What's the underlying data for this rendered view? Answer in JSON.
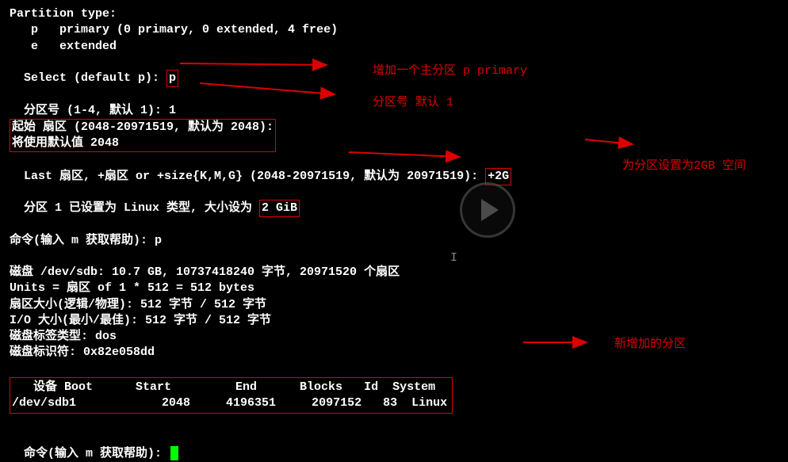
{
  "terminal": {
    "partition_type_header": "Partition type:",
    "opt_primary": "   p   primary (0 primary, 0 extended, 4 free)",
    "opt_extended": "   e   extended",
    "select_prompt": "Select (default p): ",
    "select_value": "p",
    "part_num_prompt": "分区号 (1-4, 默认 1): ",
    "part_num_value": "1",
    "start_sector_line": "起始 扇区 (2048-20971519, 默认为 2048):",
    "default_used_line": "将使用默认值 2048",
    "last_sector_prompt": "Last 扇区, +扇区 or +size{K,M,G} (2048-20971519, 默认为 20971519): ",
    "last_sector_value": "+2G",
    "set_partition_prefix": "分区 1 已设置为 Linux 类型, 大小设为 ",
    "set_partition_size": "2 GiB",
    "cmd_prompt1": "命令(输入 m 获取帮助): p",
    "disk_info": "磁盘 /dev/sdb: 10.7 GB, 10737418240 字节, 20971520 个扇区",
    "units": "Units = 扇区 of 1 * 512 = 512 bytes",
    "sector_size": "扇区大小(逻辑/物理): 512 字节 / 512 字节",
    "io_size": "I/O 大小(最小/最佳): 512 字节 / 512 字节",
    "label_type": "磁盘标签类型: dos",
    "disk_id": "磁盘标识符: 0x82e058dd",
    "cmd_prompt2": "命令(输入 m 获取帮助): "
  },
  "table": {
    "header": "   设备 Boot      Start         End      Blocks   Id  System",
    "row": "/dev/sdb1            2048     4196351     2097152   83  Linux"
  },
  "annotations": {
    "a1": "增加一个主分区 p  primary",
    "a2": "分区号  默认 1",
    "a3": "为分区设置为2GB 空间",
    "a4": "新增加的分区"
  },
  "chart_data": {
    "type": "table",
    "title": "fdisk partition table output",
    "columns": [
      "设备",
      "Boot",
      "Start",
      "End",
      "Blocks",
      "Id",
      "System"
    ],
    "rows": [
      {
        "设备": "/dev/sdb1",
        "Boot": "",
        "Start": 2048,
        "End": 4196351,
        "Blocks": 2097152,
        "Id": "83",
        "System": "Linux"
      }
    ]
  }
}
